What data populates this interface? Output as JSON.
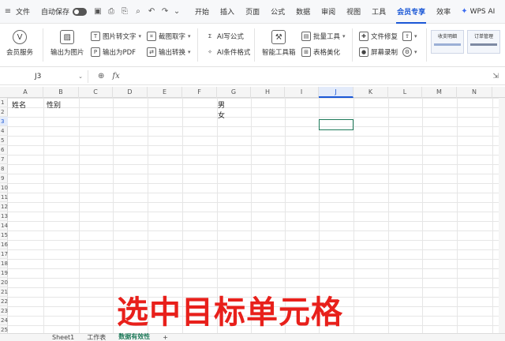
{
  "menubar": {
    "file": "文件",
    "autosave_label": "自动保存",
    "tabs": [
      {
        "label": "开始",
        "active": false
      },
      {
        "label": "插入",
        "active": false
      },
      {
        "label": "页面",
        "active": false
      },
      {
        "label": "公式",
        "active": false
      },
      {
        "label": "数据",
        "active": false
      },
      {
        "label": "审阅",
        "active": false
      },
      {
        "label": "视图",
        "active": false
      },
      {
        "label": "工具",
        "active": false
      },
      {
        "label": "会员专享",
        "active": true
      },
      {
        "label": "效率",
        "active": false
      }
    ],
    "wps_ai": "WPS AI"
  },
  "ribbon": {
    "member_service": "会员服务",
    "export_image": "输出为图片",
    "image_to_text": "图片转文字",
    "export_pdf": "输出为PDF",
    "screenshot_ocr": "截图取字",
    "export_convert": "输出转换",
    "ai_formula": "AI写公式",
    "ai_condition_format": "AI条件格式",
    "smart_toolbox": "智能工具箱",
    "batch_tools": "批量工具",
    "table_beautify": "表格美化",
    "file_repair": "文件修复",
    "screen_record": "屏幕录制",
    "thumb1": "收支明细",
    "thumb2": "订单管理"
  },
  "formulabar": {
    "cell_ref": "J3",
    "fx": "fx"
  },
  "grid": {
    "columns": [
      "A",
      "B",
      "C",
      "D",
      "E",
      "F",
      "G",
      "H",
      "I",
      "J",
      "K",
      "L",
      "M",
      "N"
    ],
    "selected_column": "J",
    "rows": [
      "1",
      "2",
      "3",
      "4",
      "5",
      "6",
      "7",
      "8",
      "9",
      "10",
      "11",
      "12",
      "13",
      "14",
      "15",
      "16",
      "17",
      "18",
      "19",
      "20",
      "21",
      "22",
      "23",
      "24",
      "25"
    ],
    "selected_row": "3",
    "cells": {
      "A1": "姓名",
      "B1": "性别",
      "G1": "男",
      "G2": "女"
    }
  },
  "caption": "选中目标单元格",
  "sheets": [
    {
      "label": "Sheet1",
      "active": false
    },
    {
      "label": "工作表",
      "active": false
    },
    {
      "label": "数据有效性",
      "active": true
    }
  ],
  "sheet_add": "+"
}
